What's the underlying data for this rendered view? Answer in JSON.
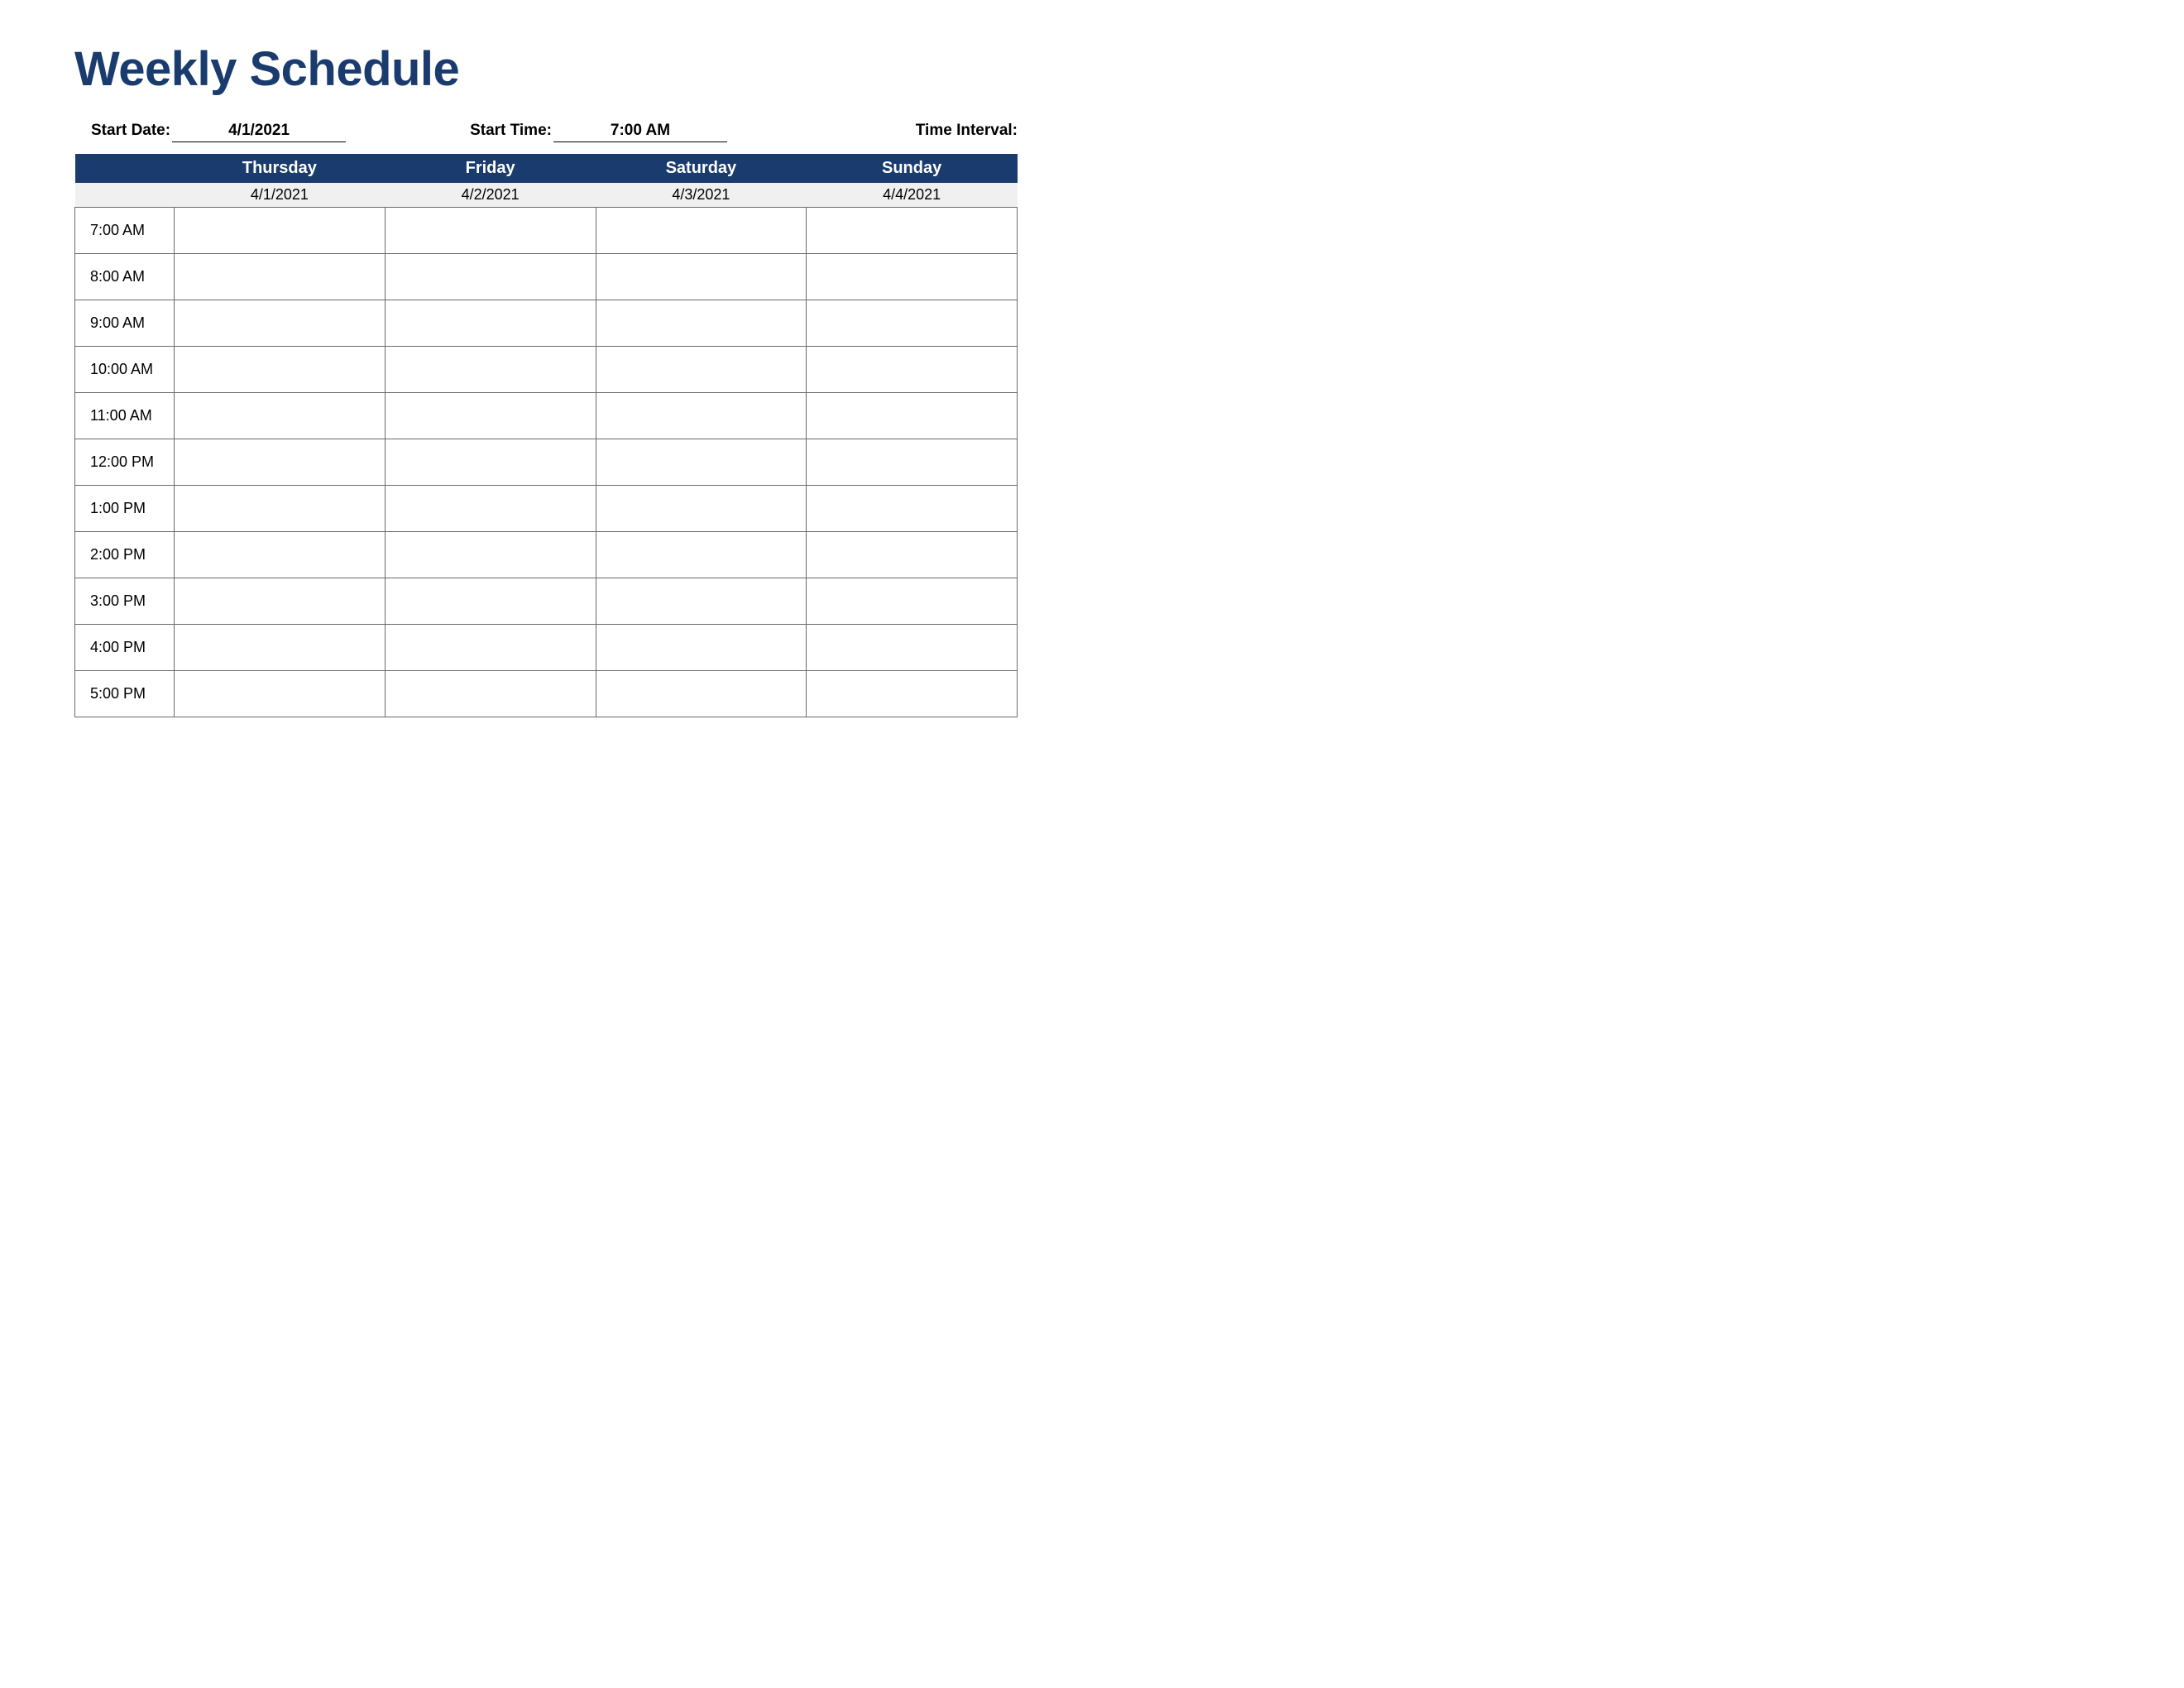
{
  "title": "Weekly Schedule",
  "meta": {
    "start_date_label": "Start Date:",
    "start_date_value": "4/1/2021",
    "start_time_label": "Start Time:",
    "start_time_value": "7:00 AM",
    "time_interval_label": "Time Interval:"
  },
  "days": [
    {
      "name": "Thursday",
      "date": "4/1/2021"
    },
    {
      "name": "Friday",
      "date": "4/2/2021"
    },
    {
      "name": "Saturday",
      "date": "4/3/2021"
    },
    {
      "name": "Sunday",
      "date": "4/4/2021"
    }
  ],
  "time_slots": [
    "7:00 AM",
    "8:00 AM",
    "9:00 AM",
    "10:00 AM",
    "11:00 AM",
    "12:00 PM",
    "1:00 PM",
    "2:00 PM",
    "3:00 PM",
    "4:00 PM",
    "5:00 PM"
  ],
  "colors": {
    "header_bg": "#1a3b6e",
    "header_text": "#ffffff",
    "subheader_bg": "#f0f0f0",
    "grid_border": "#6a6a6a"
  }
}
